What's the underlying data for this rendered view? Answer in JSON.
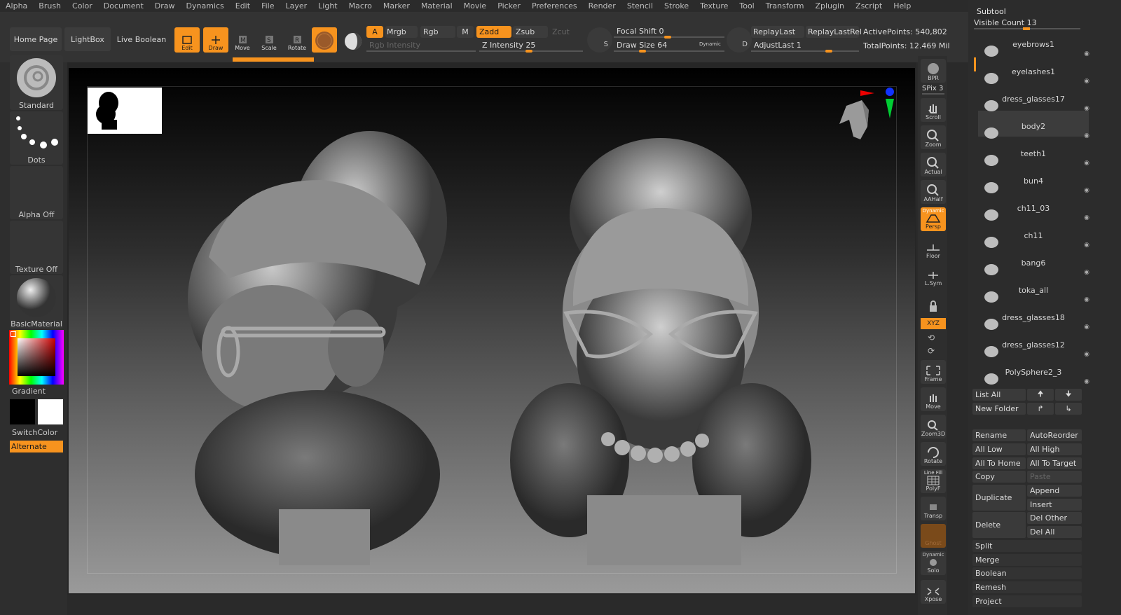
{
  "menu": [
    "Alpha",
    "Brush",
    "Color",
    "Document",
    "Draw",
    "Dynamics",
    "Edit",
    "File",
    "Layer",
    "Light",
    "Macro",
    "Marker",
    "Material",
    "Movie",
    "Picker",
    "Preferences",
    "Render",
    "Stencil",
    "Stroke",
    "Texture",
    "Tool",
    "Transform",
    "Zplugin",
    "Zscript",
    "Help"
  ],
  "shelf": {
    "home_page": "Home Page",
    "lightbox": "LightBox",
    "live_boolean": "Live Boolean",
    "edit": "Edit",
    "draw": "Draw",
    "move": "Move",
    "scale": "Scale",
    "rotate": "Rotate",
    "a": "A",
    "mrgb": "Mrgb",
    "rgb": "Rgb",
    "m": "M",
    "zadd": "Zadd",
    "zsub": "Zsub",
    "zcut": "Zcut",
    "rgb_intensity": "Rgb Intensity",
    "z_intensity": "Z Intensity 25",
    "focal_shift": "Focal Shift 0",
    "draw_size": "Draw Size 64",
    "dynamic": "Dynamic",
    "replay_last": "ReplayLast",
    "replay_last_rel": "ReplayLastRel",
    "adjust_last": "AdjustLast 1",
    "active_points": "ActivePoints: 540,802",
    "total_points": "TotalPoints: 12.469 Mil",
    "s_label": "S",
    "d_label": "D"
  },
  "left": {
    "standard": "Standard",
    "dots": "Dots",
    "alpha_off": "Alpha Off",
    "texture_off": "Texture Off",
    "basic_material": "BasicMaterial",
    "gradient": "Gradient",
    "switch_color": "SwitchColor",
    "alternate": "Alternate"
  },
  "right": {
    "bpr": "BPR",
    "spix": "SPix 3",
    "scroll": "Scroll",
    "zoom": "Zoom",
    "actual": "Actual",
    "aahalf": "AAHalf",
    "dynamic": "Dynamic",
    "persp": "Persp",
    "floor": "Floor",
    "lsym": "L.Sym",
    "xyz": "XYZ",
    "frame": "Frame",
    "move": "Move",
    "zoom3d": "Zoom3D",
    "rotate": "Rotate",
    "line_fill": "Line Fill",
    "polyf": "PolyF",
    "transp": "Transp",
    "ghost": "Ghost",
    "dynamic2": "Dynamic",
    "solo": "Solo",
    "xpose": "Xpose"
  },
  "subtool": {
    "title": "Subtool",
    "visible_count": "Visible Count 13",
    "items": [
      "eyebrows1",
      "eyelashes1",
      "dress_glasses17",
      "body2",
      "teeth1",
      "bun4",
      "ch11_03",
      "ch11",
      "bang6",
      "toka_all",
      "dress_glasses18",
      "dress_glasses12",
      "PolySphere2_3"
    ],
    "list_all": "List All",
    "new_folder": "New Folder",
    "rename": "Rename",
    "auto_reorder": "AutoReorder",
    "all_low": "All Low",
    "all_high": "All High",
    "all_to_home": "All To Home",
    "all_to_target": "All To Target",
    "copy": "Copy",
    "paste": "Paste",
    "duplicate": "Duplicate",
    "append": "Append",
    "insert": "Insert",
    "delete": "Delete",
    "del_other": "Del Other",
    "del_all": "Del All",
    "split": "Split",
    "merge": "Merge",
    "boolean": "Boolean",
    "remesh": "Remesh",
    "project": "Project"
  },
  "colors": {
    "accent": "#f7931e",
    "bg": "#2c2c2c"
  }
}
